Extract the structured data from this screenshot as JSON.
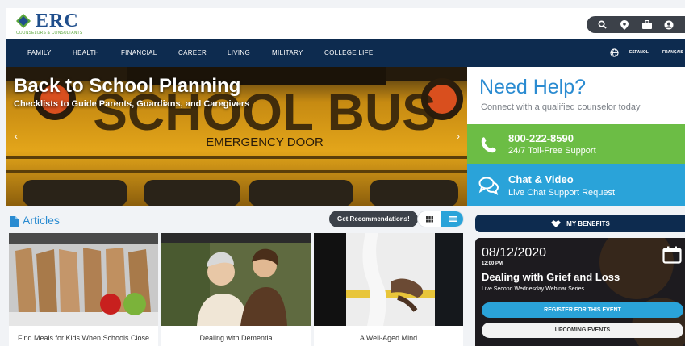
{
  "brand": {
    "logo_text": "ERC",
    "logo_tagline": "COUNSELORS & CONSULTANTS",
    "primary_color": "#0d2b4f",
    "accent_blue": "#2aa3d9",
    "accent_green": "#6cbd45"
  },
  "utility_icons": [
    "search-icon",
    "location-pin-icon",
    "briefcase-icon",
    "user-icon"
  ],
  "nav": {
    "items": [
      "FAMILY",
      "HEALTH",
      "FINANCIAL",
      "CAREER",
      "LIVING",
      "MILITARY",
      "COLLEGE LIFE"
    ],
    "lang_en_alt": "ESPANOL",
    "lang_fr": "FRANÇAIS",
    "globe_icon": "globe-icon"
  },
  "hero": {
    "title": "Back to School Planning",
    "subtitle": "Checklists to Guide Parents, Guardians, and Caregivers",
    "bus_text": "SCHOOL BUS",
    "bus_sign": "EMERGENCY DOOR",
    "prev_icon": "chevron-left-icon",
    "next_icon": "chevron-right-icon"
  },
  "help": {
    "title": "Need Help?",
    "subtitle": "Connect with a qualified counselor today",
    "phone": "800-222-8590",
    "phone_sub": "24/7 Toll-Free Support",
    "chat": "Chat & Video",
    "chat_sub": "Live Chat Support Request"
  },
  "articles": {
    "heading": "Articles",
    "get_recommendations": "Get Recommendations!",
    "cards": [
      {
        "caption": "Find Meals for Kids When Schools Close"
      },
      {
        "caption": "Dealing with Dementia"
      },
      {
        "caption": "A Well-Aged Mind"
      }
    ]
  },
  "benefits": {
    "label": "MY BENEFITS"
  },
  "event": {
    "date": "08/12/2020",
    "time": "12:00 PM",
    "title": "Dealing with Grief and Loss",
    "series": "Live Second Wednesday Webinar Series",
    "register": "REGISTER FOR THIS EVENT",
    "upcoming": "UPCOMING EVENTS"
  }
}
